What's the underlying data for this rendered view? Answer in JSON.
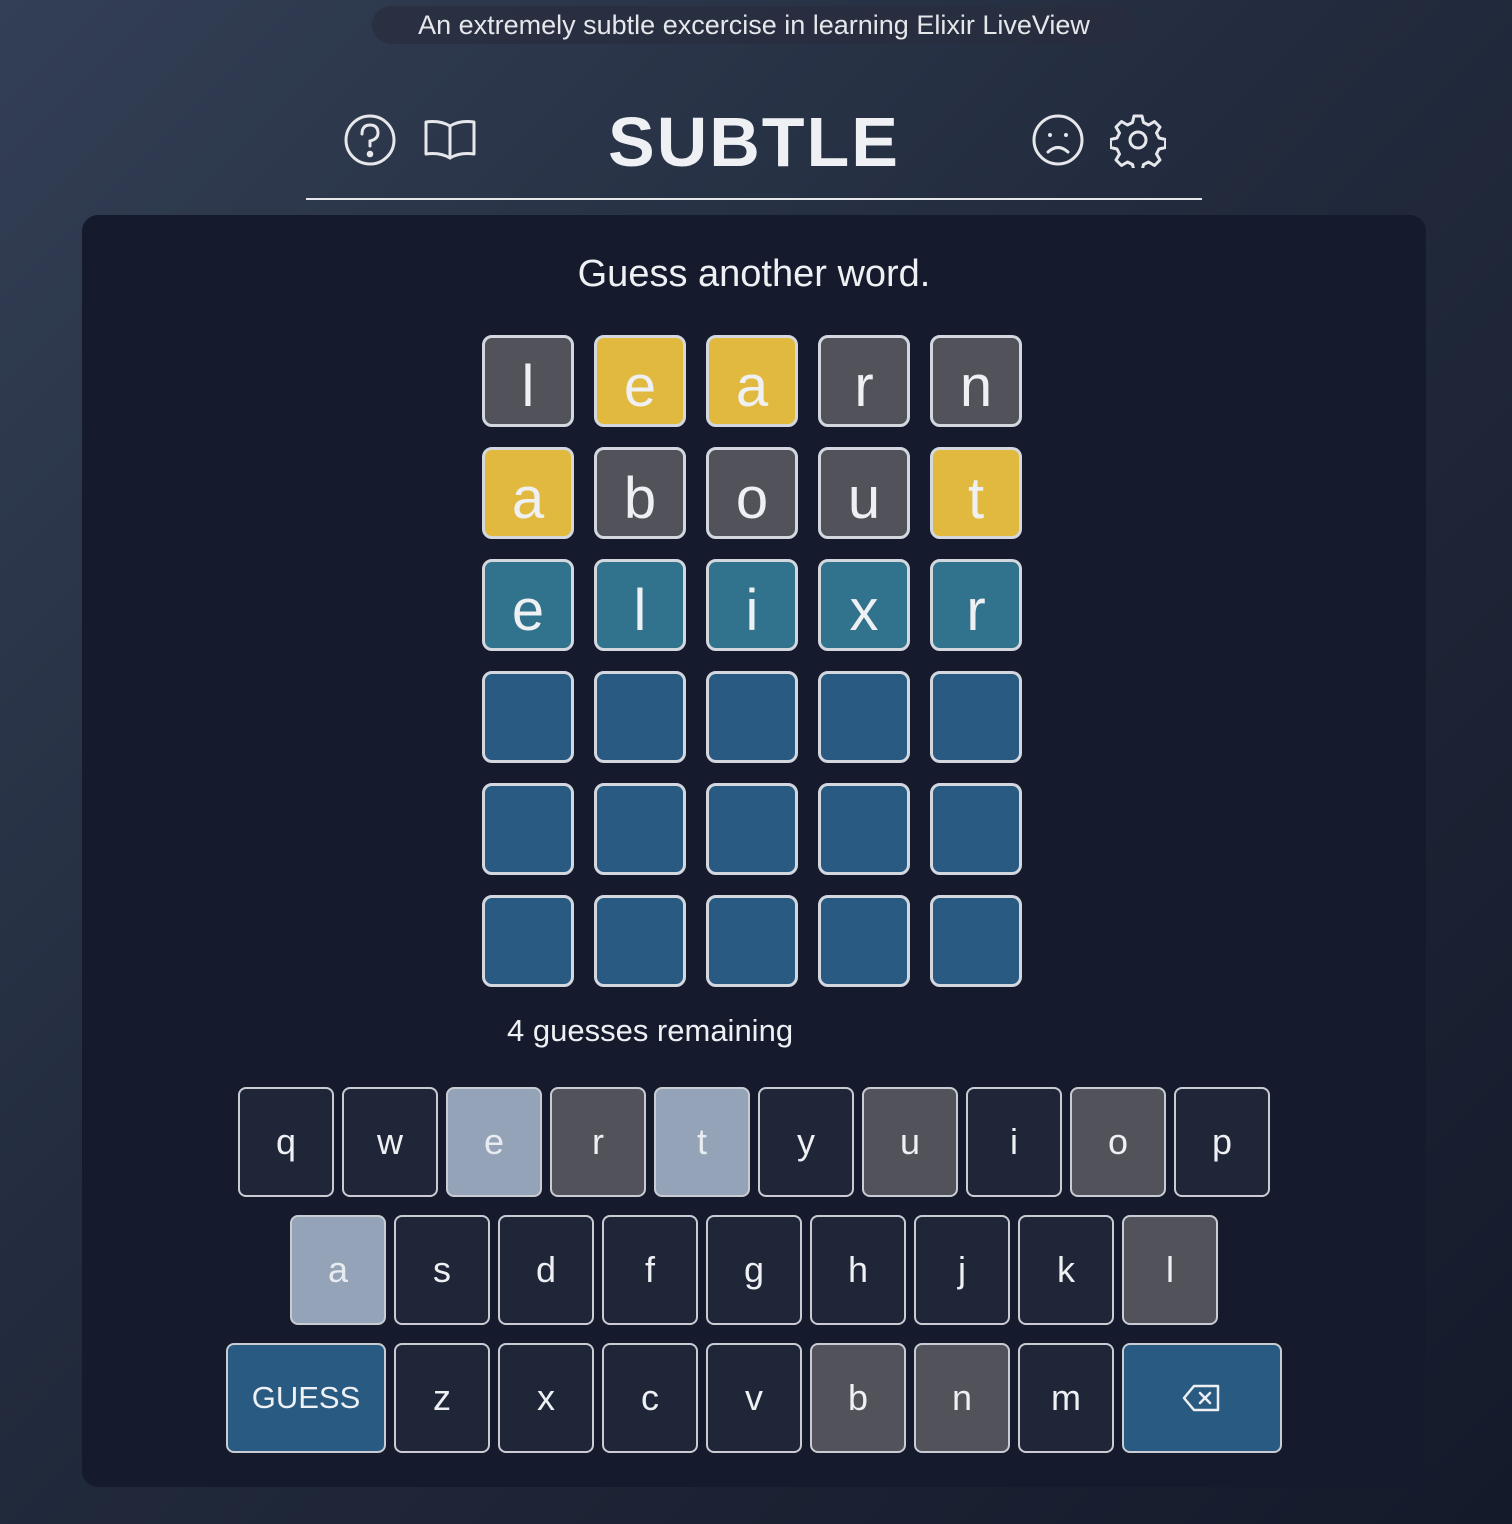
{
  "banner": "An extremely subtle excercise in learning Elixir LiveView",
  "header": {
    "title": "SUBTLE",
    "icons": [
      "help-icon",
      "book-icon",
      "sad-face-icon",
      "settings-icon"
    ]
  },
  "message": "Guess another word.",
  "board": {
    "rows": [
      [
        {
          "letter": "l",
          "state": "absent"
        },
        {
          "letter": "e",
          "state": "present"
        },
        {
          "letter": "a",
          "state": "present"
        },
        {
          "letter": "r",
          "state": "absent"
        },
        {
          "letter": "n",
          "state": "absent"
        }
      ],
      [
        {
          "letter": "a",
          "state": "present"
        },
        {
          "letter": "b",
          "state": "absent"
        },
        {
          "letter": "o",
          "state": "absent"
        },
        {
          "letter": "u",
          "state": "absent"
        },
        {
          "letter": "t",
          "state": "present"
        }
      ],
      [
        {
          "letter": "e",
          "state": "current"
        },
        {
          "letter": "l",
          "state": "current"
        },
        {
          "letter": "i",
          "state": "current"
        },
        {
          "letter": "x",
          "state": "current"
        },
        {
          "letter": "r",
          "state": "current"
        }
      ],
      [
        {
          "letter": "",
          "state": "empty"
        },
        {
          "letter": "",
          "state": "empty"
        },
        {
          "letter": "",
          "state": "empty"
        },
        {
          "letter": "",
          "state": "empty"
        },
        {
          "letter": "",
          "state": "empty"
        }
      ],
      [
        {
          "letter": "",
          "state": "empty"
        },
        {
          "letter": "",
          "state": "empty"
        },
        {
          "letter": "",
          "state": "empty"
        },
        {
          "letter": "",
          "state": "empty"
        },
        {
          "letter": "",
          "state": "empty"
        }
      ],
      [
        {
          "letter": "",
          "state": "empty"
        },
        {
          "letter": "",
          "state": "empty"
        },
        {
          "letter": "",
          "state": "empty"
        },
        {
          "letter": "",
          "state": "empty"
        },
        {
          "letter": "",
          "state": "empty"
        }
      ]
    ]
  },
  "remaining": "4 guesses remaining",
  "keyboard": {
    "rows": [
      [
        {
          "label": "q",
          "state": "unused"
        },
        {
          "label": "w",
          "state": "unused"
        },
        {
          "label": "e",
          "state": "present"
        },
        {
          "label": "r",
          "state": "absent"
        },
        {
          "label": "t",
          "state": "present"
        },
        {
          "label": "y",
          "state": "unused"
        },
        {
          "label": "u",
          "state": "absent"
        },
        {
          "label": "i",
          "state": "unused"
        },
        {
          "label": "o",
          "state": "absent"
        },
        {
          "label": "p",
          "state": "unused"
        }
      ],
      [
        {
          "label": "a",
          "state": "present"
        },
        {
          "label": "s",
          "state": "unused"
        },
        {
          "label": "d",
          "state": "unused"
        },
        {
          "label": "f",
          "state": "unused"
        },
        {
          "label": "g",
          "state": "unused"
        },
        {
          "label": "h",
          "state": "unused"
        },
        {
          "label": "j",
          "state": "unused"
        },
        {
          "label": "k",
          "state": "unused"
        },
        {
          "label": "l",
          "state": "absent"
        }
      ],
      [
        {
          "label": "GUESS",
          "state": "action"
        },
        {
          "label": "z",
          "state": "unused"
        },
        {
          "label": "x",
          "state": "unused"
        },
        {
          "label": "c",
          "state": "unused"
        },
        {
          "label": "v",
          "state": "unused"
        },
        {
          "label": "b",
          "state": "absent"
        },
        {
          "label": "n",
          "state": "absent"
        },
        {
          "label": "m",
          "state": "unused"
        },
        {
          "label": "",
          "icon": "backspace-icon",
          "state": "action"
        }
      ]
    ]
  },
  "colors": {
    "absent": "#52525b",
    "present": "#e2b93f",
    "current": "#31738c",
    "empty": "#285a82",
    "key_present": "#94a3b8",
    "key_unused": "#1e2638",
    "action": "#285a82"
  }
}
